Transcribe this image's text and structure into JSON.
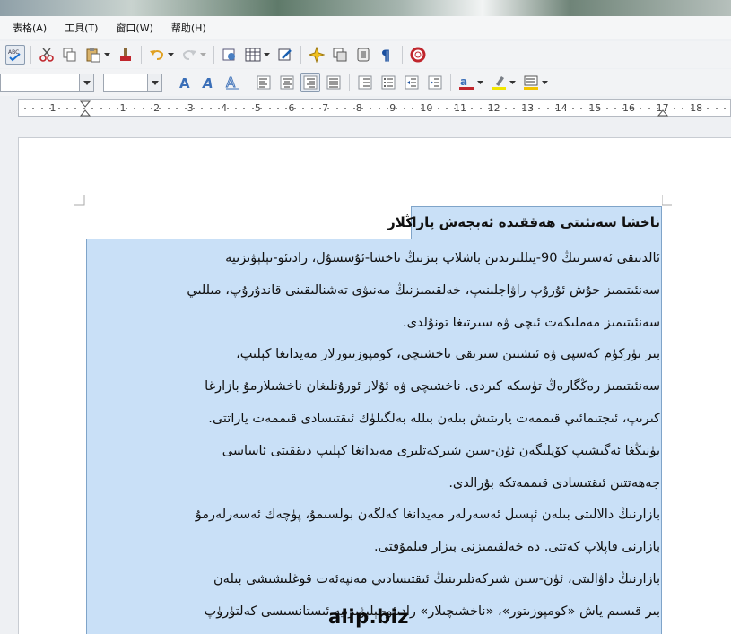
{
  "menu": [
    "表格(A)",
    "工具(T)",
    "窗口(W)",
    "帮助(H)"
  ],
  "toolbar1": {
    "icons": [
      "spellcheck-icon",
      "cut-icon",
      "copy-icon",
      "paste-icon",
      "clone-format-icon",
      "undo-icon",
      "redo-icon",
      "navigator-icon",
      "table-icon",
      "draw-functions-icon",
      "gallery-icon",
      "data-sources-icon",
      "nonprinting-icon",
      "paragraph-marks-icon",
      "help-icon"
    ]
  },
  "toolbar2": {
    "font_name": "",
    "font_size": "",
    "icons": [
      "fontwork-icon",
      "outline-font-icon",
      "shadow-font-icon",
      "align-left-icon",
      "align-center-icon",
      "align-right-icon",
      "justify-icon",
      "numbering-icon",
      "bullets-icon",
      "decrease-indent-icon",
      "increase-indent-icon",
      "font-color-icon",
      "highlight-icon",
      "background-color-icon"
    ]
  },
  "ruler": {
    "labels": [
      "1",
      "1",
      "2",
      "3",
      "4",
      "5",
      "6",
      "7",
      "8",
      "9",
      "10",
      "11",
      "12",
      "13",
      "14",
      "15",
      "16",
      "17",
      "18"
    ]
  },
  "document": {
    "title": "ناخشا سەنئىتى ھەققىدە ئەبجەش پاراڭلار",
    "lines": [
      "ئالدىنقى ئەسىرنىڭ 90-يىللىرىدىن باشلاپ بىزنىڭ ناخشا-ئۇسسۇل، رادىئو-تېلېۋىزىيە",
      "سەنئىتىمىز جۇش ئۇرۇپ راۋاجلىنىپ، خەلقىمىزنىڭ مەنىۋى تەشنالىقىنى قاندۇرۇپ، مىللىي",
      "سەنئىتىمىز مەملىكەت ئىچى ۋە سىرتىغا تونۇلدى.",
      "بىر تۈركۈم كەسپى ۋە ئىشتىن سىرتقى ناخشىچى، كومپوزىتورلار مەيدانغا كېلىپ،",
      "سەنئىتىمىز رەڭگارەڭ تۈسكە كىردى. ناخشىچى ۋە ئۇلار ئورۇنلىغان ناخشىلارمۇ بازارغا",
      "كىرىپ، ئىجتىمائىي قىممەت يارىتىش بىلەن بىللە بەلگىلۈك ئىقتىسادى قىممەت ياراتتى.",
      "بۈنىڭغا ئەگىشىپ كۆپلىگەن ئۈن-سىن شىركەتلىرى مەيدانغا كېلىپ دىققىتى ئاساسى",
      "جەھەتتىن ئىقتىسادى قىممەتكە بۇرالدى.",
      "بازارنىڭ دالالىتى بىلەن ئېسىل ئەسەرلەر مەيدانغا كەلگەن بولسىمۇ، پۈچەك ئەسەرلەرمۇ",
      "بازارنى قاپلاپ كەتتى. ده خەلقىمىزنى بىزار قىلمۇقتى.",
      "بازارنىڭ داۋالىتى، ئۈن-سىن شىركەتلىرىنىڭ ئىقتىسادىي مەنپەئەت قوغلىشىشى بىلەن",
      "بىر قىسىم ياش «كومپوزىتور»، «ناخشىچىلار» رادىئو-تېلېۋىزىيە ئىستانسىسى كەلتۈرۈپ"
    ]
  },
  "watermark": "alip.biz"
}
